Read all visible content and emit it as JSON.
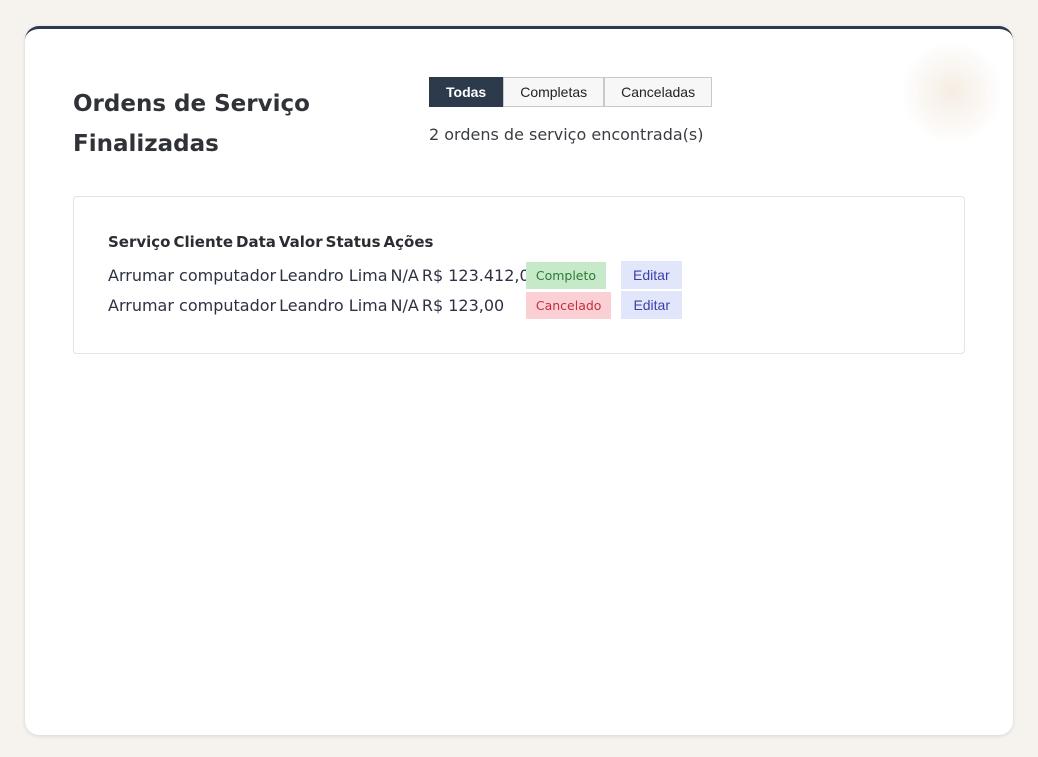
{
  "page": {
    "title": "Ordens de Serviço Finalizadas",
    "count_text": "2 ordens de serviço encontrada(s)"
  },
  "filters": [
    {
      "label": "Todas",
      "active": true
    },
    {
      "label": "Completas",
      "active": false
    },
    {
      "label": "Canceladas",
      "active": false
    }
  ],
  "table": {
    "headers": [
      "Serviço",
      "Cliente",
      "Data",
      "Valor",
      "Status",
      "Ações"
    ],
    "rows": [
      {
        "servico": "Arrumar computador",
        "cliente": "Leandro Lima",
        "data": "N/A",
        "valor": "R$ 123.412,00",
        "status": "Completo",
        "acao": "Editar"
      },
      {
        "servico": "Arrumar computador",
        "cliente": "Leandro Lima",
        "data": "N/A",
        "valor": "R$ 123,00",
        "status": "Cancelado",
        "acao": "Editar"
      }
    ]
  },
  "colors": {
    "accent": "#2c3a4b",
    "status_complete_bg": "#c6e9c9",
    "status_canceled_bg": "#fbd0d5",
    "edit_bg": "#e2e6fb"
  }
}
